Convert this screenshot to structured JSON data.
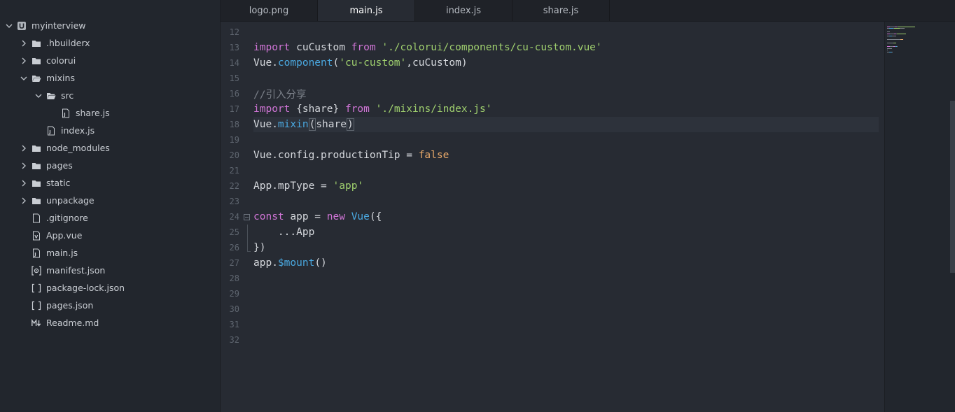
{
  "sidebar": {
    "items": [
      {
        "label": "myinterview",
        "depth": 0,
        "kind": "project",
        "icon": "project-icon",
        "expanded": true,
        "chevron": "down"
      },
      {
        "label": ".hbuilderx",
        "depth": 1,
        "kind": "folder",
        "icon": "folder-icon",
        "chevron": "right"
      },
      {
        "label": "colorui",
        "depth": 1,
        "kind": "folder",
        "icon": "folder-icon",
        "chevron": "right"
      },
      {
        "label": "mixins",
        "depth": 1,
        "kind": "folder",
        "icon": "folder-open-icon",
        "chevron": "down"
      },
      {
        "label": "src",
        "depth": 2,
        "kind": "folder",
        "icon": "folder-open-icon",
        "chevron": "down"
      },
      {
        "label": "share.js",
        "depth": 3,
        "kind": "file",
        "icon": "js-file-icon",
        "chevron": "none"
      },
      {
        "label": "index.js",
        "depth": 2,
        "kind": "file",
        "icon": "js-file-icon",
        "chevron": "none"
      },
      {
        "label": "node_modules",
        "depth": 1,
        "kind": "folder",
        "icon": "folder-icon",
        "chevron": "right"
      },
      {
        "label": "pages",
        "depth": 1,
        "kind": "folder",
        "icon": "folder-icon",
        "chevron": "right"
      },
      {
        "label": "static",
        "depth": 1,
        "kind": "folder",
        "icon": "folder-icon",
        "chevron": "right"
      },
      {
        "label": "unpackage",
        "depth": 1,
        "kind": "folder",
        "icon": "folder-icon",
        "chevron": "right"
      },
      {
        "label": ".gitignore",
        "depth": 1,
        "kind": "file",
        "icon": "file-icon",
        "chevron": "none"
      },
      {
        "label": "App.vue",
        "depth": 1,
        "kind": "file",
        "icon": "vue-file-icon",
        "chevron": "none"
      },
      {
        "label": "main.js",
        "depth": 1,
        "kind": "file",
        "icon": "js-file-icon",
        "chevron": "none"
      },
      {
        "label": "manifest.json",
        "depth": 1,
        "kind": "file",
        "icon": "manifest-file-icon",
        "chevron": "none"
      },
      {
        "label": "package-lock.json",
        "depth": 1,
        "kind": "file",
        "icon": "json-file-icon",
        "chevron": "none"
      },
      {
        "label": "pages.json",
        "depth": 1,
        "kind": "file",
        "icon": "json-file-icon",
        "chevron": "none"
      },
      {
        "label": "Readme.md",
        "depth": 1,
        "kind": "file",
        "icon": "markdown-file-icon",
        "chevron": "none"
      }
    ]
  },
  "tabs": [
    {
      "label": "logo.png",
      "active": false
    },
    {
      "label": "main.js",
      "active": true
    },
    {
      "label": "index.js",
      "active": false
    },
    {
      "label": "share.js",
      "active": false
    }
  ],
  "editor": {
    "current_line": 18,
    "lines": [
      {
        "n": "12",
        "tokens": []
      },
      {
        "n": "13",
        "tokens": [
          [
            "kw",
            "import"
          ],
          [
            "pl",
            " cuCustom "
          ],
          [
            "kw",
            "from"
          ],
          [
            "pl",
            " "
          ],
          [
            "str",
            "'./colorui/components/cu-custom.vue'"
          ]
        ]
      },
      {
        "n": "14",
        "tokens": [
          [
            "pl",
            "Vue."
          ],
          [
            "fn",
            "component"
          ],
          [
            "pl",
            "("
          ],
          [
            "str",
            "'cu-custom'"
          ],
          [
            "pl",
            ",cuCustom)"
          ]
        ]
      },
      {
        "n": "15",
        "tokens": []
      },
      {
        "n": "16",
        "tokens": [
          [
            "cm",
            "//引入分享"
          ]
        ]
      },
      {
        "n": "17",
        "tokens": [
          [
            "kw",
            "import"
          ],
          [
            "pl",
            " {share} "
          ],
          [
            "kw",
            "from"
          ],
          [
            "pl",
            " "
          ],
          [
            "str",
            "'./mixins/index.js'"
          ]
        ]
      },
      {
        "n": "18",
        "tokens": [
          [
            "pl",
            "Vue."
          ],
          [
            "fn",
            "mixin"
          ],
          [
            "br",
            "("
          ],
          [
            "pl",
            "share"
          ],
          [
            "br",
            ")"
          ]
        ]
      },
      {
        "n": "19",
        "tokens": []
      },
      {
        "n": "20",
        "tokens": [
          [
            "pl",
            "Vue.config.productionTip = "
          ],
          [
            "bool",
            "false"
          ]
        ]
      },
      {
        "n": "21",
        "tokens": []
      },
      {
        "n": "22",
        "tokens": [
          [
            "pl",
            "App.mpType = "
          ],
          [
            "str",
            "'app'"
          ]
        ]
      },
      {
        "n": "23",
        "tokens": []
      },
      {
        "n": "24",
        "tokens": [
          [
            "kw",
            "const"
          ],
          [
            "pl",
            " app = "
          ],
          [
            "kw",
            "new"
          ],
          [
            "pl",
            " "
          ],
          [
            "fn",
            "Vue"
          ],
          [
            "pl",
            "({"
          ]
        ],
        "fold": true
      },
      {
        "n": "25",
        "tokens": [
          [
            "pl",
            "    ...App"
          ]
        ]
      },
      {
        "n": "26",
        "tokens": [
          [
            "pl",
            "})"
          ]
        ]
      },
      {
        "n": "27",
        "tokens": [
          [
            "pl",
            "app."
          ],
          [
            "fn",
            "$mount"
          ],
          [
            "pl",
            "()"
          ]
        ]
      },
      {
        "n": "28",
        "tokens": []
      },
      {
        "n": "29",
        "tokens": []
      },
      {
        "n": "30",
        "tokens": []
      },
      {
        "n": "31",
        "tokens": []
      },
      {
        "n": "32",
        "tokens": []
      }
    ]
  },
  "colors": {
    "keyword": "#d075d6",
    "function": "#4aa8e0",
    "string": "#9fcf6e",
    "boolean": "#e8a96a",
    "comment": "#7b8089"
  }
}
